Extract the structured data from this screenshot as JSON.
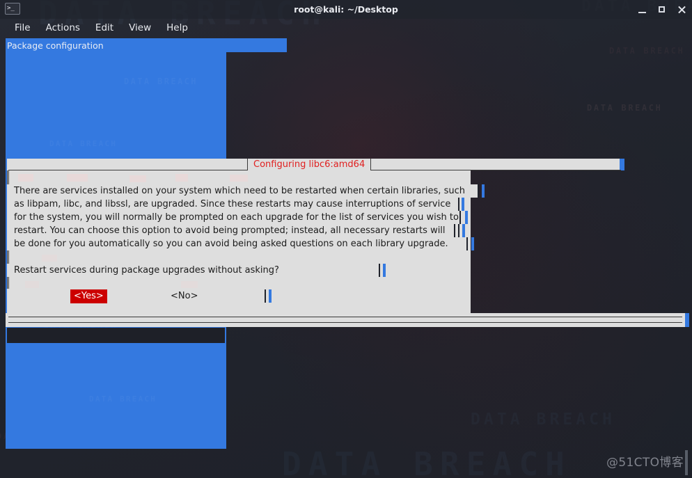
{
  "window": {
    "title": "root@kali: ~/Desktop",
    "icon": "terminal-icon",
    "controls": {
      "minimize": "minimize-icon",
      "maximize": "maximize-icon",
      "close": "close-icon"
    }
  },
  "menubar": {
    "items": [
      "File",
      "Actions",
      "Edit",
      "View",
      "Help"
    ]
  },
  "dpkg_panel": {
    "header": "Package configuration",
    "bg_color": "#3479e0"
  },
  "dialog": {
    "title": "Configuring libc6:amd64",
    "title_color": "#e02020",
    "bg_color": "#dedede",
    "body_lines": [
      "There are services installed on your system which need to be restarted when certain libraries, such",
      "as libpam, libc, and libssl, are upgraded. Since these restarts may cause interruptions of service",
      "for the system, you will normally be prompted on each upgrade for the list of services you wish to",
      "restart.  You can choose this option to avoid being prompted; instead, all necessary restarts will",
      "be done for you automatically so you can avoid being asked questions on each library upgrade."
    ],
    "question": "Restart services during package upgrades without asking?",
    "buttons": [
      {
        "label": "<Yes>",
        "selected": true,
        "bg": "#cc0000",
        "fg": "#ffffff"
      },
      {
        "label": "<No>",
        "selected": false,
        "bg": "#dedede",
        "fg": "#1b1b1b"
      }
    ]
  },
  "watermarks": {
    "desktop": "DATA BREACH",
    "credit": "@51CTO博客"
  }
}
